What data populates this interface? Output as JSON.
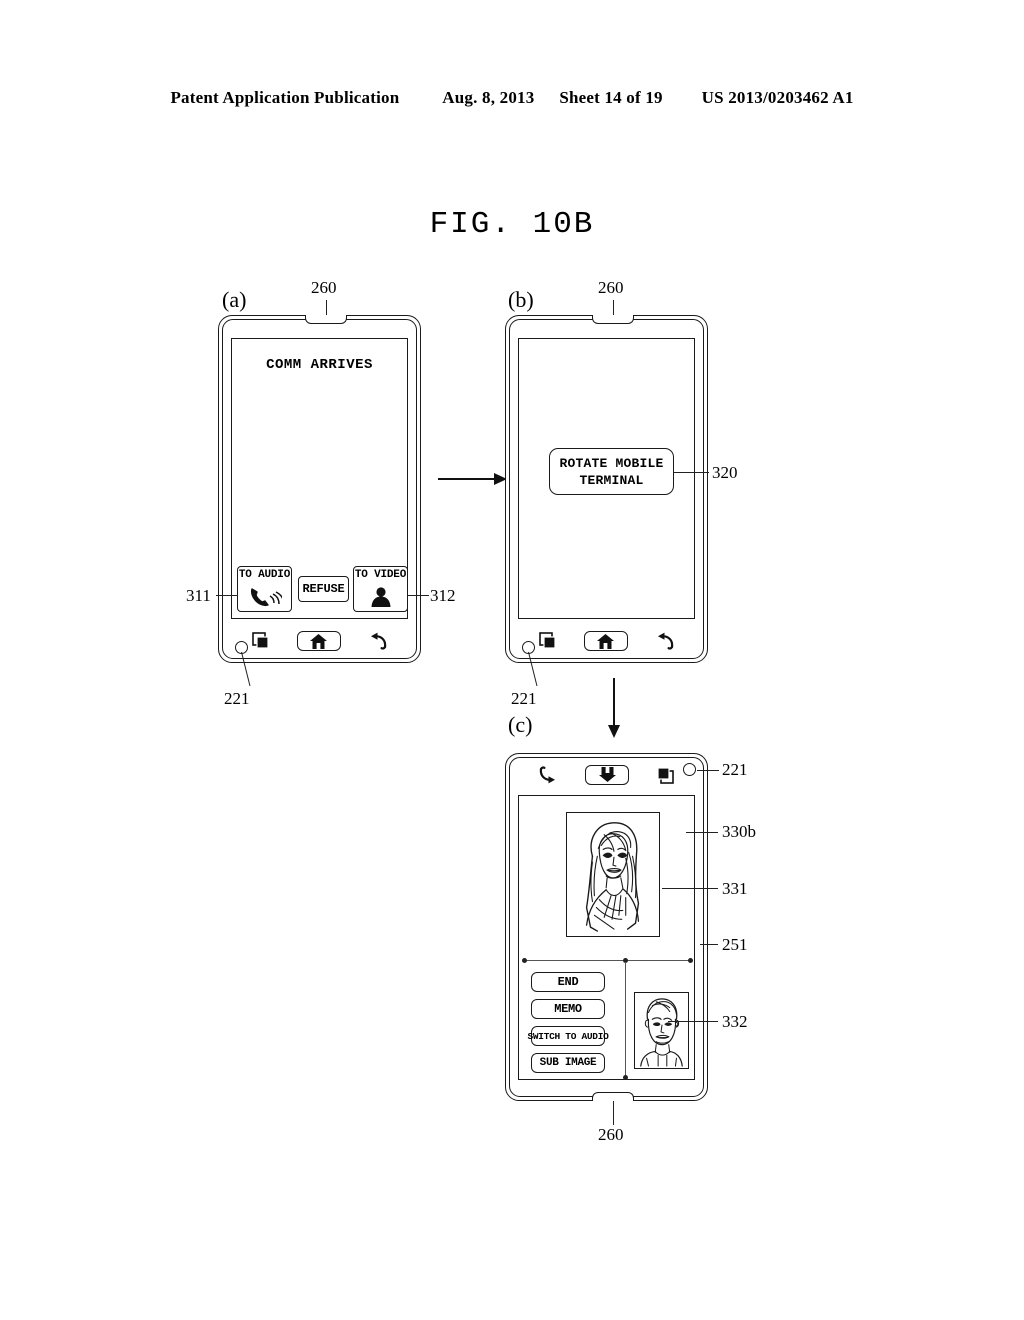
{
  "header": {
    "publication": "Patent Application Publication",
    "date": "Aug. 8, 2013",
    "sheet": "Sheet 14 of 19",
    "patent_number": "US 2013/0203462 A1"
  },
  "figure": {
    "title": "FIG.  10B"
  },
  "panels": {
    "a": {
      "letter": "(a)",
      "screen_title": "COMM ARRIVES",
      "buttons": [
        {
          "label": "TO AUDIO",
          "icon": "phone-ringing-icon",
          "ref": "311"
        },
        {
          "label": "REFUSE",
          "icon": "none"
        },
        {
          "label": "TO VIDEO",
          "icon": "person-icon",
          "ref": "312"
        }
      ],
      "nav": [
        {
          "icon": "menu-window-icon"
        },
        {
          "icon": "home-icon"
        },
        {
          "icon": "back-arrow-icon"
        }
      ],
      "refs": {
        "speaker": "260",
        "camera": "221",
        "to_audio": "311",
        "to_video": "312"
      }
    },
    "b": {
      "letter": "(b)",
      "dialog_line1": "ROTATE MOBILE",
      "dialog_line2": "TERMINAL",
      "nav": [
        {
          "icon": "menu-window-icon"
        },
        {
          "icon": "home-icon"
        },
        {
          "icon": "back-arrow-icon"
        }
      ],
      "refs": {
        "speaker": "260",
        "camera": "221",
        "dialog": "320"
      }
    },
    "c": {
      "letter": "(c)",
      "nav": [
        {
          "icon": "back-arrow-icon"
        },
        {
          "icon": "home-icon"
        },
        {
          "icon": "menu-window-icon"
        }
      ],
      "buttons": [
        {
          "label": "END"
        },
        {
          "label": "MEMO"
        },
        {
          "label": "SWITCH TO AUDIO"
        },
        {
          "label": "SUB IMAGE"
        }
      ],
      "main_image": "woman-portrait-illustration",
      "sub_image": "man-portrait-illustration",
      "refs": {
        "camera": "221",
        "display": "330b",
        "main_image": "331",
        "panel": "251",
        "sub_image": "332",
        "speaker": "260"
      }
    }
  },
  "flow": {
    "arrow_a_to_b": "right-arrow",
    "arrow_b_to_c": "down-arrow"
  }
}
